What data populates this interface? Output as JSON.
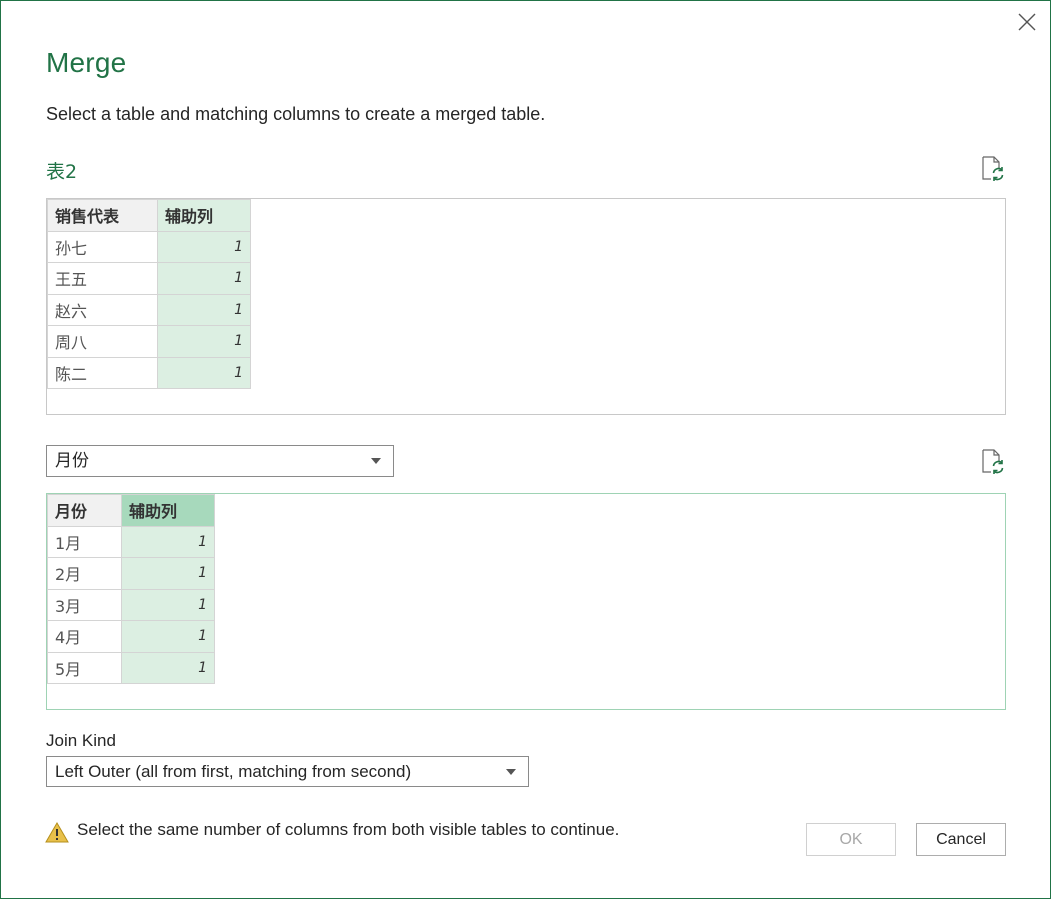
{
  "dialog": {
    "title": "Merge",
    "subtitle": "Select a table and matching columns to create a merged table."
  },
  "table1": {
    "name": "表2",
    "columns": [
      "销售代表",
      "辅助列"
    ],
    "rows": [
      [
        "孙七",
        "1"
      ],
      [
        "王五",
        "1"
      ],
      [
        "赵六",
        "1"
      ],
      [
        "周八",
        "1"
      ],
      [
        "陈二",
        "1"
      ]
    ]
  },
  "table2": {
    "selected_table": "月份",
    "columns": [
      "月份",
      "辅助列"
    ],
    "rows": [
      [
        "1月",
        "1"
      ],
      [
        "2月",
        "1"
      ],
      [
        "3月",
        "1"
      ],
      [
        "4月",
        "1"
      ],
      [
        "5月",
        "1"
      ]
    ]
  },
  "join": {
    "label": "Join Kind",
    "value": "Left Outer (all from first, matching from second)"
  },
  "warning": "Select the same number of columns from both visible tables to continue.",
  "buttons": {
    "ok": "OK",
    "cancel": "Cancel"
  },
  "colors": {
    "accent": "#217346",
    "selected_cell": "#dcefe2",
    "selected_header": "#a7d9bc"
  },
  "icons": [
    "close-icon",
    "refresh-icon",
    "chevron-down-icon",
    "warning-icon"
  ]
}
